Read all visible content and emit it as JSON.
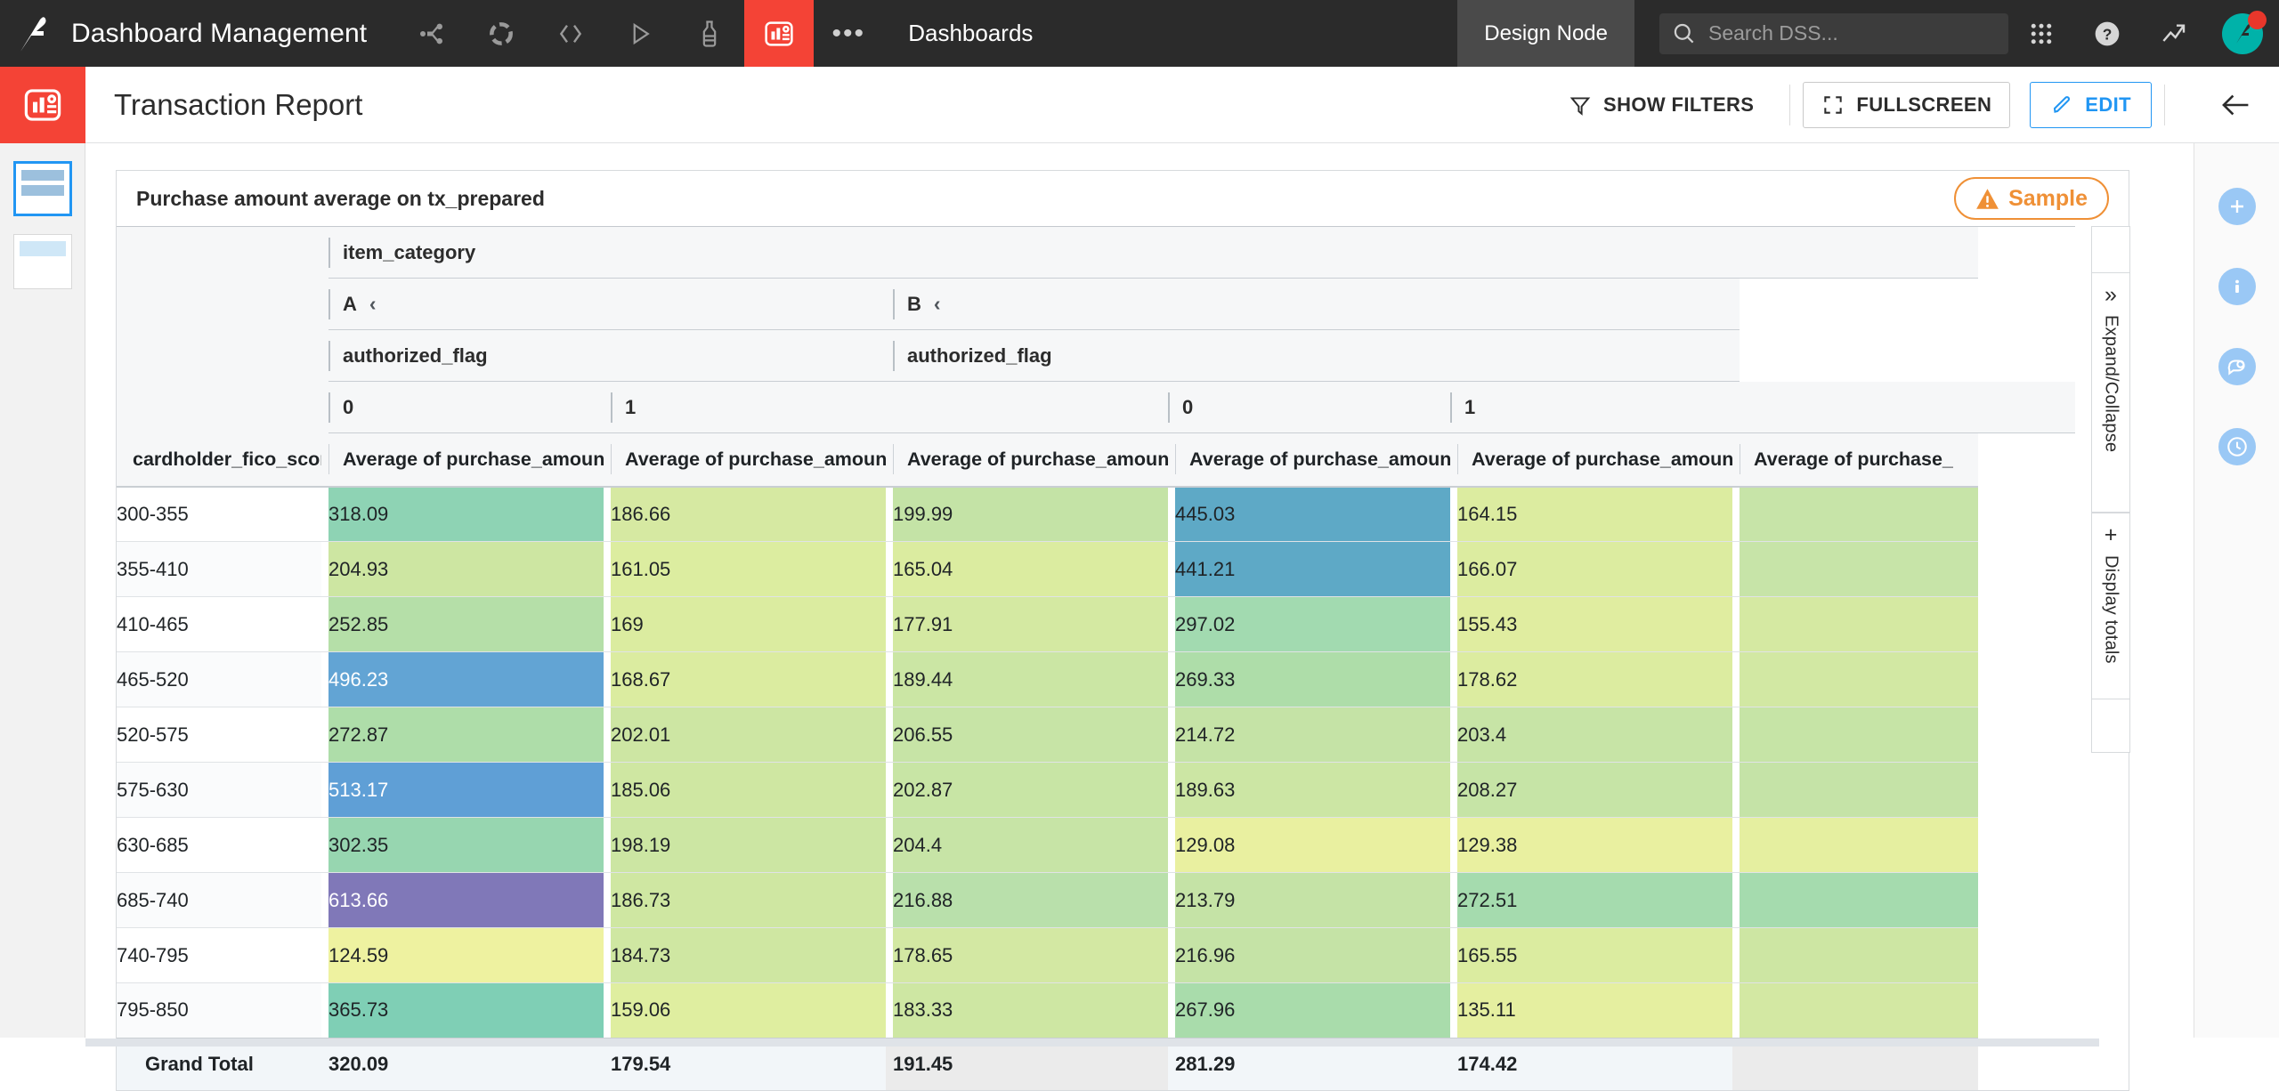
{
  "topbar": {
    "app_title": "Dashboard Management",
    "section_label": "Dashboards",
    "design_node": "Design Node",
    "search_placeholder": "Search DSS...",
    "icons": [
      "flow-icon",
      "recipe-icon",
      "code-icon",
      "play-icon",
      "lab-icon",
      "dashboard-icon",
      "more-icon"
    ]
  },
  "header": {
    "page_title": "Transaction Report",
    "show_filters": "SHOW FILTERS",
    "fullscreen": "FULLSCREEN",
    "edit": "EDIT"
  },
  "widget": {
    "title": "Purchase amount average on tx_prepared",
    "sample_badge": "Sample"
  },
  "side_tabs": {
    "expand_collapse": "Expand/Collapse",
    "display_totals": "Display totals"
  },
  "chart_data": {
    "type": "table",
    "title": "Purchase amount average on tx_prepared",
    "column_dimension_name": "item_category",
    "column_dimension_values": [
      "A",
      "B"
    ],
    "sub_dimension_name": "authorized_flag",
    "sub_dimension_values": [
      "0",
      "1"
    ],
    "row_dimension_name": "cardholder_fico_score",
    "measure_label": "Average of purchase_amount",
    "measure_label_truncated": "Average of purchase_",
    "columns": [
      {
        "label": "Average of purchase_amount",
        "item_category": "A",
        "authorized_flag": "0"
      },
      {
        "label": "Average of purchase_amount",
        "item_category": "A",
        "authorized_flag": "1"
      },
      {
        "label": "Average of purchase_amount",
        "item_category": "A",
        "authorized_flag": "1"
      },
      {
        "label": "Average of purchase_amount",
        "item_category": "B",
        "authorized_flag": "0"
      },
      {
        "label": "Average of purchase_amount",
        "item_category": "B",
        "authorized_flag": "1"
      },
      {
        "label": "Average of purchase_",
        "item_category": "B",
        "authorized_flag": "1"
      }
    ],
    "categories": [
      "300-355",
      "355-410",
      "410-465",
      "465-520",
      "520-575",
      "575-630",
      "630-685",
      "685-740",
      "740-795",
      "795-850"
    ],
    "rows": [
      {
        "label": "300-355",
        "values": [
          "318.09",
          "186.66",
          "199.99",
          "445.03",
          "164.15",
          ""
        ],
        "colors": [
          "#8ed3b4",
          "#d6e9a2",
          "#c4e3a6",
          "#5ea9c6",
          "#dcecA0",
          "#c7e4a8"
        ],
        "text": [
          "dark",
          "dark",
          "dark",
          "dark",
          "dark",
          "dark"
        ]
      },
      {
        "label": "355-410",
        "values": [
          "204.93",
          "161.05",
          "165.04",
          "441.21",
          "166.07",
          ""
        ],
        "colors": [
          "#cde6a2",
          "#dcedA0",
          "#dbecA0",
          "#5ea9c6",
          "#dcecA0",
          "#c7e4a8"
        ],
        "text": [
          "dark",
          "dark",
          "dark",
          "dark",
          "dark",
          "dark"
        ]
      },
      {
        "label": "410-465",
        "values": [
          "252.85",
          "169",
          "177.91",
          "297.02",
          "155.43",
          ""
        ],
        "colors": [
          "#b5dfa8",
          "#dbeca0",
          "#d4e9a2",
          "#a2dab0",
          "#e0eda0",
          "#d5e9a2"
        ],
        "text": [
          "dark",
          "dark",
          "dark",
          "dark",
          "dark",
          "dark"
        ]
      },
      {
        "label": "465-520",
        "values": [
          "496.23",
          "168.67",
          "189.44",
          "269.33",
          "178.62",
          ""
        ],
        "colors": [
          "#62a4d4",
          "#dbeca0",
          "#cbe6a4",
          "#aedda9",
          "#dce ca0",
          "#d2e8a3"
        ],
        "text": [
          "light",
          "dark",
          "dark",
          "dark",
          "dark",
          "dark"
        ]
      },
      {
        "label": "520-575",
        "values": [
          "272.87",
          "202.01",
          "206.55",
          "214.72",
          "203.4",
          ""
        ],
        "colors": [
          "#aedda9",
          "#cde6a3",
          "#c7e4a6",
          "#c5e3a6",
          "#c7e4a6",
          "#c6e4a6"
        ],
        "text": [
          "dark",
          "dark",
          "dark",
          "dark",
          "dark",
          "dark"
        ]
      },
      {
        "label": "575-630",
        "values": [
          "513.17",
          "185.06",
          "202.87",
          "189.63",
          "208.27",
          ""
        ],
        "colors": [
          "#5f9fd6",
          "#cfe7a2",
          "#c8e5a5",
          "#cce6a4",
          "#c6e4a6",
          "#c5e3a7"
        ],
        "text": [
          "light",
          "dark",
          "dark",
          "dark",
          "dark",
          "dark"
        ]
      },
      {
        "label": "630-685",
        "values": [
          "302.35",
          "198.19",
          "204.4",
          "129.08",
          "129.38",
          ""
        ],
        "colors": [
          "#97d6b0",
          "#cce6a3",
          "#c7e4a6",
          "#e9f0a0",
          "#e9f0a0",
          "#e5efa0"
        ],
        "text": [
          "dark",
          "dark",
          "dark",
          "dark",
          "dark",
          "dark"
        ]
      },
      {
        "label": "685-740",
        "values": [
          "613.66",
          "186.73",
          "216.88",
          "213.79",
          "272.51",
          ""
        ],
        "colors": [
          "#8078b8",
          "#cfe7a2",
          "#b9e0ab",
          "#c5e3a6",
          "#a5dbae",
          "#a5dbae"
        ],
        "text": [
          "light",
          "dark",
          "dark",
          "dark",
          "dark",
          "dark"
        ]
      },
      {
        "label": "740-795",
        "values": [
          "124.59",
          "184.73",
          "178.65",
          "216.96",
          "165.55",
          ""
        ],
        "colors": [
          "#eef2a0",
          "#cfe7a2",
          "#d3e8a3",
          "#c5e3a6",
          "#dbeca0",
          "#cde6a3"
        ],
        "text": [
          "dark",
          "dark",
          "dark",
          "dark",
          "dark",
          "dark"
        ]
      },
      {
        "label": "795-850",
        "values": [
          "365.73",
          "159.06",
          "183.33",
          "267.96",
          "135.11",
          ""
        ],
        "colors": [
          "#7fcfb5",
          "#dfeea0",
          "#cee7a3",
          "#a9dcab",
          "#e5efa0",
          "#d3e8a3"
        ],
        "text": [
          "dark",
          "dark",
          "dark",
          "dark",
          "dark",
          "dark"
        ]
      }
    ],
    "grand_total": {
      "label": "Grand Total",
      "values": [
        "320.09",
        "179.54",
        "191.45",
        "281.29",
        "174.42",
        ""
      ]
    },
    "row_header": "cardholder_fico_score"
  },
  "colors": {
    "brand_red": "#f44336",
    "accent_blue": "#2196f3",
    "topbar_bg": "#2b2b2b",
    "sample_orange": "#ef9036"
  }
}
